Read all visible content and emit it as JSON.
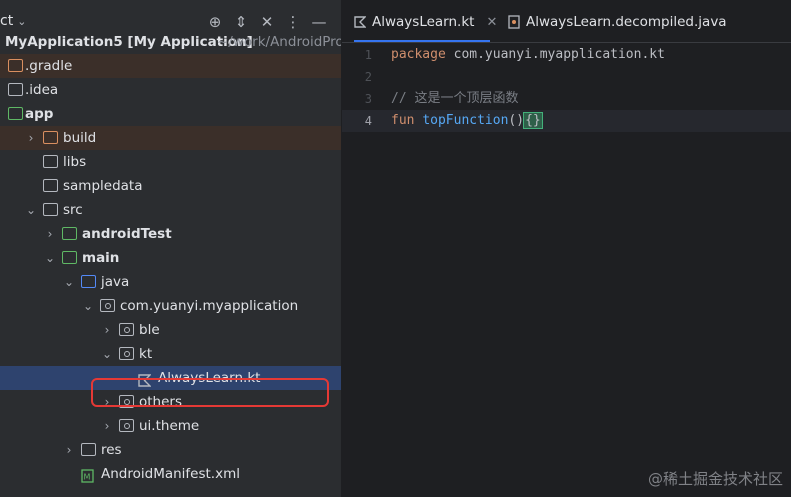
{
  "project_panel": {
    "title": "ct",
    "tree": [
      {
        "label": "MyApplication5 [My Application]",
        "suffix": "~/work/AndroidProje",
        "arrow": "",
        "icon": "none"
      },
      {
        "label": ".gradle",
        "arrow": "",
        "icon": "folder-orange"
      },
      {
        "label": ".idea",
        "arrow": "",
        "icon": "folder"
      },
      {
        "label": "app",
        "arrow": "",
        "icon": "module"
      },
      {
        "label": "build",
        "arrow": "›",
        "icon": "folder-orange"
      },
      {
        "label": "libs",
        "arrow": "",
        "icon": "folder"
      },
      {
        "label": "sampledata",
        "arrow": "",
        "icon": "folder"
      },
      {
        "label": "src",
        "arrow": "⌄",
        "icon": "folder"
      },
      {
        "label": "androidTest",
        "arrow": "›",
        "icon": "folder-green"
      },
      {
        "label": "main",
        "arrow": "⌄",
        "icon": "folder-green"
      },
      {
        "label": "java",
        "arrow": "⌄",
        "icon": "folder-blue"
      },
      {
        "label": "com.yuanyi.myapplication",
        "arrow": "⌄",
        "icon": "package"
      },
      {
        "label": "ble",
        "arrow": "›",
        "icon": "package"
      },
      {
        "label": "kt",
        "arrow": "⌄",
        "icon": "package"
      },
      {
        "label": "AlwaysLearn.kt",
        "arrow": "",
        "icon": "kotlin-file"
      },
      {
        "label": "others",
        "arrow": "›",
        "icon": "package"
      },
      {
        "label": "ui.theme",
        "arrow": "›",
        "icon": "package"
      },
      {
        "label": "res",
        "arrow": "›",
        "icon": "resources-folder"
      },
      {
        "label": "AndroidManifest.xml",
        "arrow": "",
        "icon": "manifest-file"
      }
    ]
  },
  "editor": {
    "tabs": [
      {
        "label": "AlwaysLearn.kt",
        "icon": "kotlin-file-icon",
        "active": true,
        "close": "✕"
      },
      {
        "label": "AlwaysLearn.decompiled.java",
        "icon": "java-file-icon",
        "active": false
      }
    ],
    "lines": [
      {
        "num": "1",
        "tokens": [
          {
            "t": "package",
            "c": "kw"
          },
          {
            "t": " com.yuanyi.myapplication.kt",
            "c": "plain"
          }
        ]
      },
      {
        "num": "2",
        "tokens": []
      },
      {
        "num": "3",
        "tokens": [
          {
            "t": "// 这是一个顶层函数",
            "c": "comment"
          }
        ]
      },
      {
        "num": "4",
        "tokens": [
          {
            "t": "fun",
            "c": "kw"
          },
          {
            "t": " ",
            "c": "plain"
          },
          {
            "t": "topFunction",
            "c": "fn"
          },
          {
            "t": "()",
            "c": "plain"
          },
          {
            "t": "{}",
            "c": "brace"
          }
        ]
      }
    ]
  },
  "watermark": "@稀土掘金技术社区"
}
